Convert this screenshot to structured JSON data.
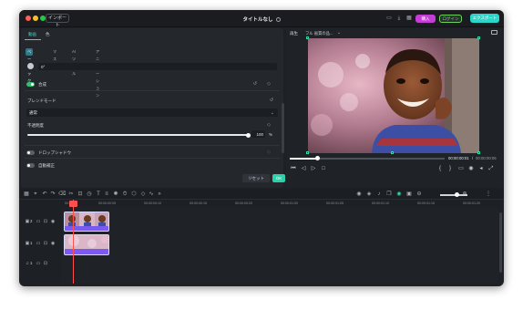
{
  "titlebar": {
    "import_label": "インポート",
    "title": "タイトルなし",
    "purchase_label": "購入",
    "login_label": "ログイン",
    "export_label": "エクスポート",
    "colors": {
      "close": "#fe5f57",
      "minimize": "#febc2e",
      "maximize": "#28c840",
      "purchase": "#c43ed6",
      "login": "#6cd35a",
      "export": "#2ad6c9"
    }
  },
  "props": {
    "tabs": [
      "動画",
      "色"
    ],
    "subtabs": [
      "ベーシック",
      "マスク",
      "AIツール",
      "アニメーション"
    ],
    "rotation_value": "0°",
    "compositing_label": "合成",
    "blend_mode_label": "ブレンドモード",
    "blend_mode_value": "通常",
    "opacity_label": "不透明度",
    "opacity_value": "100",
    "opacity_unit": "%",
    "opacity_fraction": 1.0,
    "drop_shadow_label": "ドロップシャドウ",
    "auto_correct_label": "自動補正",
    "reset_label": "リセット",
    "ok_label": "OK"
  },
  "player": {
    "tab_label": "再生",
    "quality_label": "フル 画質の品...",
    "current_time": "00:00:00:01",
    "separator": "/",
    "total_time": "00:00:00:05",
    "progress_fraction": 0.18
  },
  "timeline": {
    "ruler_ticks": [
      "00:00",
      "00:00:00:05",
      "00:00:00:10",
      "00:00:00:15",
      "00:00:00:20",
      "00:00:01:00",
      "00:00:01:05",
      "00:00:01:10",
      "00:00:01:15",
      "00:00:01:20"
    ],
    "tracks": [
      {
        "label": "2",
        "clip_color": "#7a5af0"
      },
      {
        "label": "1",
        "clip_color": "#7a5af0"
      },
      {
        "label": "1",
        "type": "audio"
      }
    ]
  }
}
